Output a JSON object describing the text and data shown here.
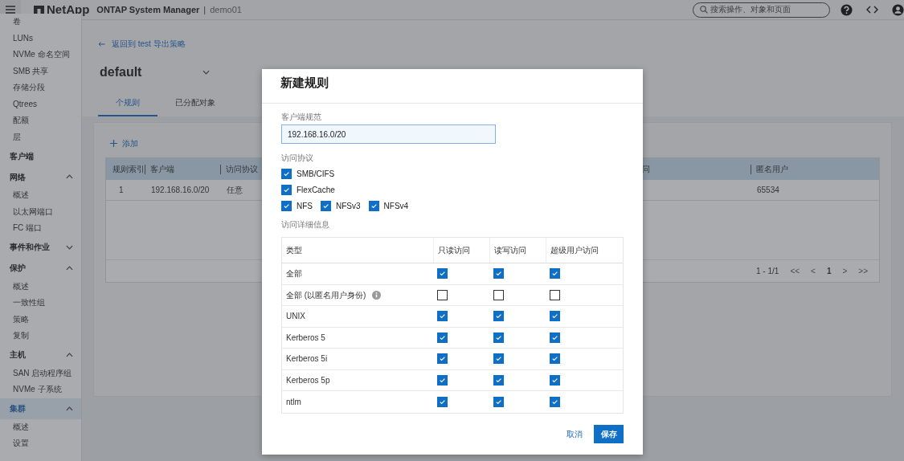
{
  "header": {
    "product": "NetApp",
    "app_title": "ONTAP System Manager",
    "separator": "|",
    "cluster": "demo01",
    "search": {
      "placeholder": "搜索操作、对象和页面"
    }
  },
  "sidebar": {
    "items": [
      {
        "kind": "link",
        "label": "卷"
      },
      {
        "kind": "link",
        "label": "LUNs"
      },
      {
        "kind": "link",
        "label": "NVMe 命名空间"
      },
      {
        "kind": "link",
        "label": "SMB 共享"
      },
      {
        "kind": "link",
        "label": "存储分段"
      },
      {
        "kind": "link",
        "label": "Qtrees"
      },
      {
        "kind": "link",
        "label": "配额"
      },
      {
        "kind": "link",
        "label": "层"
      },
      {
        "kind": "group",
        "label": "客户端",
        "selected": false
      },
      {
        "kind": "group",
        "label": "网络",
        "expanded": true,
        "selected": false,
        "children": [
          {
            "kind": "link",
            "label": "概述"
          },
          {
            "kind": "link",
            "label": "以太网端口"
          },
          {
            "kind": "link",
            "label": "FC 端口"
          }
        ]
      },
      {
        "kind": "group",
        "label": "事件和作业",
        "expanded": false,
        "selected": false
      },
      {
        "kind": "group",
        "label": "保护",
        "expanded": true,
        "selected": false,
        "children": [
          {
            "kind": "link",
            "label": "概述"
          },
          {
            "kind": "link",
            "label": "一致性组"
          },
          {
            "kind": "link",
            "label": "策略"
          },
          {
            "kind": "link",
            "label": "复制"
          }
        ]
      },
      {
        "kind": "group",
        "label": "主机",
        "expanded": true,
        "selected": false,
        "children": [
          {
            "kind": "link",
            "label": "SAN 启动程序组"
          },
          {
            "kind": "link",
            "label": "NVMe 子系统"
          }
        ]
      },
      {
        "kind": "group",
        "label": "集群",
        "expanded": true,
        "selected": true,
        "children": [
          {
            "kind": "link",
            "label": "概述"
          },
          {
            "kind": "link",
            "label": "设置"
          }
        ]
      }
    ]
  },
  "page": {
    "back_link": "返回到 test 导出策略",
    "title": "default",
    "tabs": [
      {
        "label": "个规则",
        "selected": true
      },
      {
        "label": "已分配对象",
        "selected": false
      }
    ],
    "add_button": "添加",
    "table": {
      "columns": [
        "规则索引",
        "客户端",
        "访问协议",
        "问",
        "匿名用户"
      ],
      "rows": [
        [
          "1",
          "192.168.16.0/20",
          "任意",
          "",
          "65534"
        ]
      ]
    },
    "pagination": {
      "range": "1 - 1/1",
      "first": "<<",
      "prev": "<",
      "page": "1",
      "next": ">",
      "last": ">>"
    }
  },
  "dialog": {
    "title": "新建规则",
    "client_label": "客户端规范",
    "client_value": "192.168.16.0/20",
    "protocol_label": "访问协议",
    "protocols": [
      [
        {
          "label": "SMB/CIFS",
          "checked": true
        }
      ],
      [
        {
          "label": "FlexCache",
          "checked": true
        }
      ],
      [
        {
          "label": "NFS",
          "checked": true
        },
        {
          "label": "NFSv3",
          "checked": true
        },
        {
          "label": "NFSv4",
          "checked": true
        }
      ]
    ],
    "details_label": "访问详细信息",
    "access_table": {
      "columns": [
        "类型",
        "只读访问",
        "读写访问",
        "超级用户访问"
      ],
      "rows": [
        {
          "type": "全部",
          "read_only": true,
          "read_write": true,
          "superuser": true
        },
        {
          "type": "全部 (以匿名用户身份)",
          "info": true,
          "read_only": false,
          "read_write": false,
          "superuser": false
        },
        {
          "type": "UNIX",
          "read_only": true,
          "read_write": true,
          "superuser": true
        },
        {
          "type": "Kerberos 5",
          "read_only": true,
          "read_write": true,
          "superuser": true
        },
        {
          "type": "Kerberos 5i",
          "read_only": true,
          "read_write": true,
          "superuser": true
        },
        {
          "type": "Kerberos 5p",
          "read_only": true,
          "read_write": true,
          "superuser": true
        },
        {
          "type": "ntlm",
          "read_only": true,
          "read_write": true,
          "superuser": true
        }
      ]
    },
    "cancel": "取消",
    "save": "保存"
  }
}
